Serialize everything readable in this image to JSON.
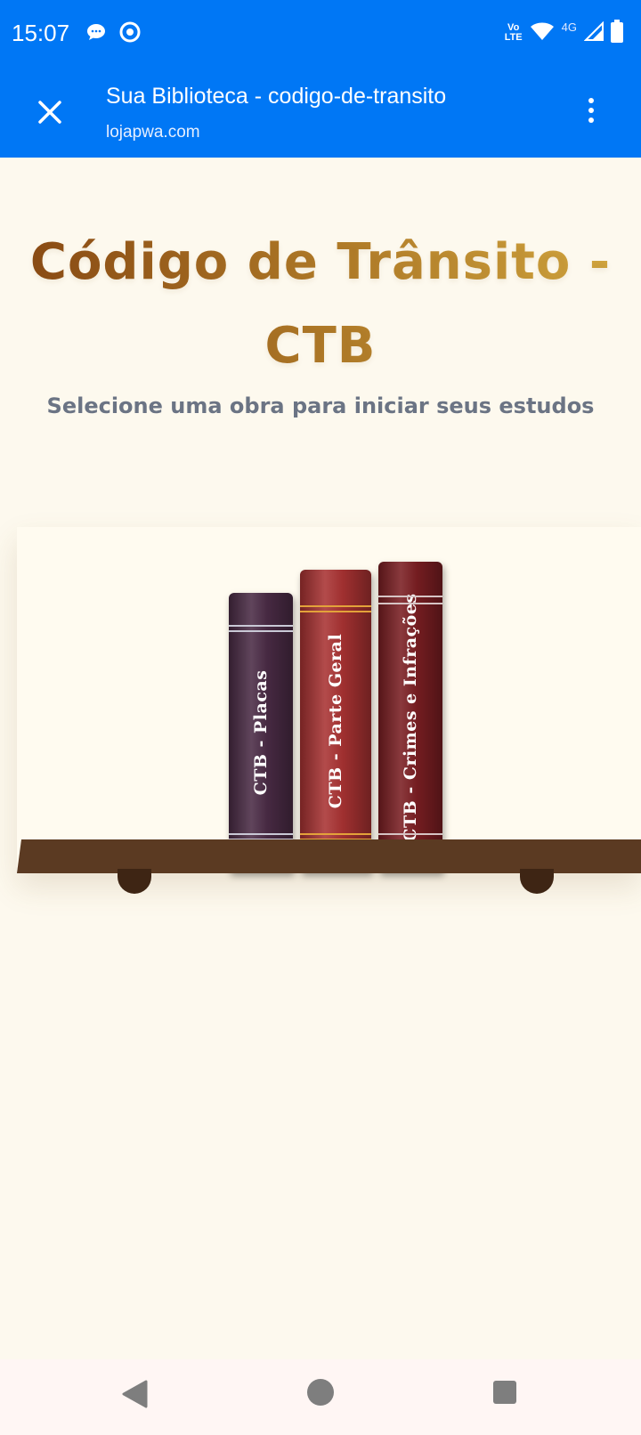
{
  "status_bar": {
    "time": "15:07",
    "left_icons": [
      "chat-bubble-icon",
      "chrome-icon"
    ],
    "volte": [
      "Vo",
      "LTE"
    ],
    "network": "4G",
    "right_icons": [
      "wifi-icon",
      "signal-icon",
      "battery-icon"
    ]
  },
  "custom_tab": {
    "title": "Sua Biblioteca - codigo-de-transito",
    "url": "lojapwa.com",
    "close_icon": "close-icon",
    "menu_icon": "more-vert-icon"
  },
  "page": {
    "title": "Código de Trânsito - CTB",
    "subtitle": "Selecione uma obra para iniciar seus estudos"
  },
  "books": [
    {
      "title": "CTB - Placas",
      "color": "#4a2b45"
    },
    {
      "title": "CTB - Parte Geral",
      "color": "#a83232"
    },
    {
      "title": "CTB - Crimes e Infrações",
      "color": "#7a1e22"
    }
  ],
  "colors": {
    "header": "#0077f5",
    "background": "#fdf9ee",
    "title_gradient": [
      "#8a4a14",
      "#d4a840"
    ],
    "subtitle": "#6b7484",
    "shelf": "#5b3a22"
  },
  "nav_bar": {
    "icons": [
      "back-icon",
      "home-icon",
      "recents-icon"
    ]
  }
}
